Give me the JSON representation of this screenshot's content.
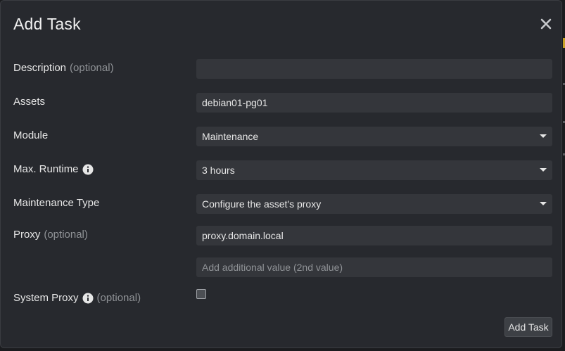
{
  "dialog": {
    "title": "Add Task",
    "close_icon": "close-icon"
  },
  "form": {
    "description": {
      "label": "Description",
      "optional": "(optional)",
      "value": "",
      "placeholder": ""
    },
    "assets": {
      "label": "Assets",
      "value": "debian01-pg01"
    },
    "module": {
      "label": "Module",
      "value": "Maintenance"
    },
    "max_runtime": {
      "label": "Max. Runtime",
      "icon": "info-icon",
      "value": "3 hours"
    },
    "maintenance_type": {
      "label": "Maintenance Type",
      "value": "Configure the asset's proxy"
    },
    "proxy": {
      "label": "Proxy",
      "optional": "(optional)",
      "value": "proxy.domain.local",
      "additional_placeholder": "Add additional value (2nd value)"
    },
    "system_proxy": {
      "label": "System Proxy",
      "icon": "info-icon",
      "optional": "(optional)",
      "checked": false
    }
  },
  "actions": {
    "submit_label": "Add Task"
  },
  "colors": {
    "dialog_bg": "#27292e",
    "field_bg": "#34363b",
    "muted_text": "#8f9296"
  }
}
